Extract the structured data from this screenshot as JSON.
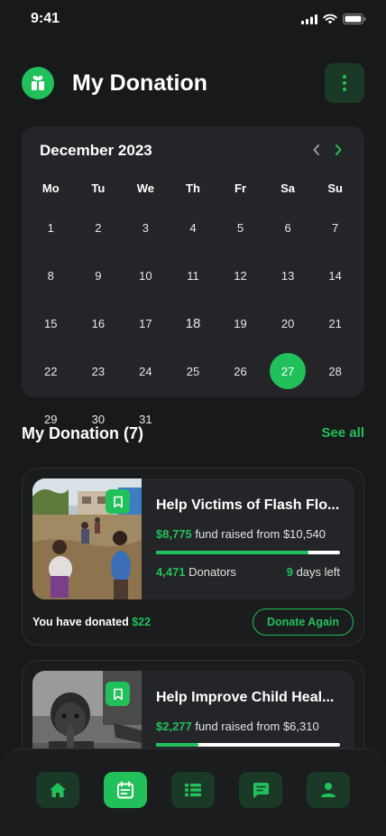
{
  "status_bar": {
    "time": "9:41"
  },
  "header": {
    "title": "My Donation",
    "logo_icon": "gift-heart-icon",
    "menu_icon": "more-vertical-icon"
  },
  "calendar": {
    "month_label": "December 2023",
    "weekdays": [
      "Mo",
      "Tu",
      "We",
      "Th",
      "Fr",
      "Sa",
      "Su"
    ],
    "weeks": [
      [
        "1",
        "2",
        "3",
        "4",
        "5",
        "6",
        "7"
      ],
      [
        "8",
        "9",
        "10",
        "11",
        "12",
        "13",
        "14"
      ],
      [
        "15",
        "16",
        "17",
        "18",
        "19",
        "20",
        "21"
      ],
      [
        "22",
        "23",
        "24",
        "25",
        "26",
        "27",
        "28"
      ],
      [
        "29",
        "30",
        "31",
        "",
        "",
        "",
        ""
      ]
    ],
    "selected_day": "27"
  },
  "section": {
    "title": "My Donation (7)",
    "see_all": "See all"
  },
  "donations": [
    {
      "title": "Help Victims of Flash Flo...",
      "raised": "$8,775",
      "raised_text": "fund raised from",
      "goal": "$10,540",
      "progress": 0.83,
      "donators_count": "4,471",
      "donators_label": "Donators",
      "days_count": "9",
      "days_label": "days left",
      "you_donated_label": "You have donated",
      "you_donated_amount": "$22",
      "action_label": "Donate Again"
    },
    {
      "title": "Help Improve Child Heal...",
      "raised": "$2,277",
      "raised_text": "fund raised from",
      "goal": "$6,310",
      "progress": 0.23
    }
  ],
  "bottom_nav": [
    {
      "icon": "home-icon",
      "active": false
    },
    {
      "icon": "calendar-icon",
      "active": true
    },
    {
      "icon": "list-icon",
      "active": false
    },
    {
      "icon": "chat-icon",
      "active": false
    },
    {
      "icon": "profile-icon",
      "active": false
    }
  ],
  "colors": {
    "accent": "#22c05a",
    "background": "#18191b",
    "card": "#242528",
    "muted_button": "#1a3a27"
  }
}
